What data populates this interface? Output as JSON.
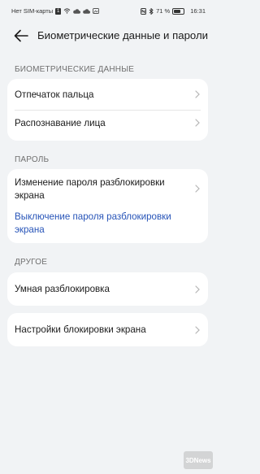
{
  "status_bar": {
    "carrier": "Нет SIM-карты",
    "sim_badge": "1",
    "battery_percent": "71 %",
    "battery_level": 0.71,
    "time": "16:31",
    "icons": [
      "sim-icon",
      "wifi-icon",
      "cloud-icon",
      "cloud-icon",
      "image-icon",
      "nfc-icon",
      "bluetooth-icon",
      "battery-icon"
    ]
  },
  "header": {
    "title": "Биометрические данные и пароли",
    "back_icon": "arrow-left-icon"
  },
  "sections": {
    "biometric": {
      "label": "БИОМЕТРИЧЕСКИЕ ДАННЫЕ",
      "items": [
        {
          "label": "Отпечаток пальца"
        },
        {
          "label": "Распознавание лица"
        }
      ]
    },
    "password": {
      "label": "ПАРОЛЬ",
      "items": [
        {
          "label": "Изменение пароля разблокировки экрана"
        },
        {
          "label": "Выключение пароля разблокировки экрана"
        }
      ]
    },
    "other": {
      "label": "ДРУГОЕ",
      "items": [
        {
          "label": "Умная разблокировка"
        }
      ]
    },
    "lock_settings": {
      "items": [
        {
          "label": "Настройки блокировки экрана"
        }
      ]
    }
  },
  "watermark": {
    "text": "3DNews"
  },
  "colors": {
    "background": "#f1f3f5",
    "card": "#ffffff",
    "link": "#2754b8",
    "section_label": "#6f6f6f"
  }
}
